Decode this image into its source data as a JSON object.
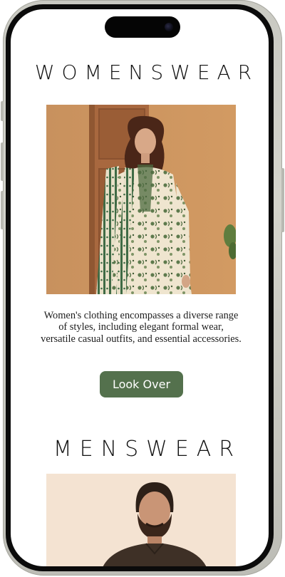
{
  "colors": {
    "accent": "#54714d",
    "background": "#ffffff",
    "text": "#111111",
    "frame": "#0b0b0b"
  },
  "women_section": {
    "title": "WOMENSWEAR",
    "description": "Women's clothing encompasses a diverse range of styles, including elegant formal wear, versatile casual outfits, and essential accessories.",
    "button_label": "Look Over"
  },
  "men_section": {
    "title": "MENSWEAR"
  }
}
